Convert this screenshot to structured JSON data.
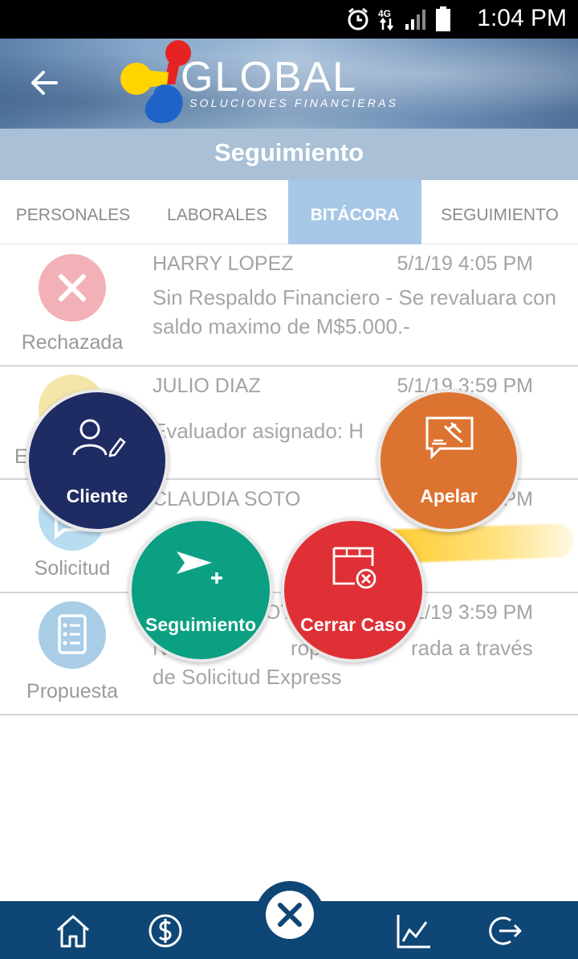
{
  "status_bar": {
    "time": "1:04 PM",
    "network": "4G"
  },
  "header": {
    "brand": "GLOBAL",
    "brand_sub": "SOLUCIONES FINANCIERAS",
    "back_icon": "arrow-left-icon"
  },
  "page": {
    "title": "Seguimiento"
  },
  "tabs": [
    {
      "label": "PERSONALES",
      "active": false
    },
    {
      "label": "LABORALES",
      "active": false
    },
    {
      "label": "BITÁCORA",
      "active": true
    },
    {
      "label": "SEGUIMIENTO",
      "active": false
    }
  ],
  "entries": [
    {
      "status": "Rechazada",
      "name": "HARRY LOPEZ",
      "date": "5/1/19 4:05 PM",
      "message": "Sin Respaldo Financiero - Se revaluara con saldo maximo de M$5.000.-",
      "icon": "close-icon",
      "color": "#f2b1b6"
    },
    {
      "status": "E",
      "name": "JULIO DIAZ",
      "date": "5/1/19 3:59 PM",
      "message": "Evaluador asignado: H",
      "icon": "status-icon",
      "color": "#f3e6a8"
    },
    {
      "status": "Solicitud",
      "name": "CLAUDIA SOTO",
      "date": "PM",
      "message": "",
      "icon": "chat-icon",
      "color": "#b8dcf0"
    },
    {
      "status": "Propuesta",
      "name": "OT",
      "date": "1/19 3:59 PM",
      "message_line1_start": "N",
      "message_line1_mid": "ropuesta",
      "message_line1_end": "rada a través",
      "message_line2": "de Solicitud Express",
      "icon": "checklist-icon",
      "color": "#a9cde6"
    }
  ],
  "actions": {
    "cliente": {
      "label": "Cliente",
      "color": "#1f2b63",
      "icon": "user-edit-icon"
    },
    "apelar": {
      "label": "Apelar",
      "color": "#dd7330",
      "icon": "gavel-chat-icon"
    },
    "seguimiento": {
      "label": "Seguimiento",
      "color": "#0aa081",
      "icon": "send-plus-icon"
    },
    "cerrar": {
      "label": "Cerrar Caso",
      "color": "#df3036",
      "icon": "folder-close-icon"
    }
  },
  "bottom_nav": [
    "home-icon",
    "dollar-icon",
    "close-icon",
    "chart-icon",
    "logout-icon"
  ]
}
